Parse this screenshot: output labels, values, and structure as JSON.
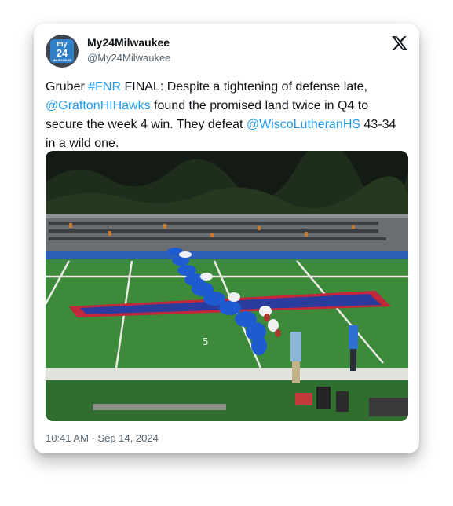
{
  "tweet": {
    "display_name": "My24Milwaukee",
    "handle": "@My24Milwaukee",
    "avatar": {
      "line1": "my",
      "line2": "24",
      "line3": "MILWAUKEE"
    },
    "text": [
      {
        "t": "Gruber ",
        "link": false
      },
      {
        "t": "#FNR",
        "link": true
      },
      {
        "t": " FINAL: Despite a tightening of defense late, ",
        "link": false
      },
      {
        "t": "@GraftonHIHawks",
        "link": true
      },
      {
        "t": " found the promised land twice in Q4 to secure the week 4 win. They defeat ",
        "link": false
      },
      {
        "t": "@WiscoLutheranHS",
        "link": true
      },
      {
        "t": " 43-34 in a wild one.",
        "link": false
      }
    ],
    "timestamp": "10:41 AM · Sep 14, 2024"
  },
  "media": {
    "field_marker": "5"
  },
  "icons": {
    "brand": "x-logo-icon"
  },
  "colors": {
    "link": "#1d9bf0",
    "text": "#0f1419",
    "muted": "#536471"
  }
}
